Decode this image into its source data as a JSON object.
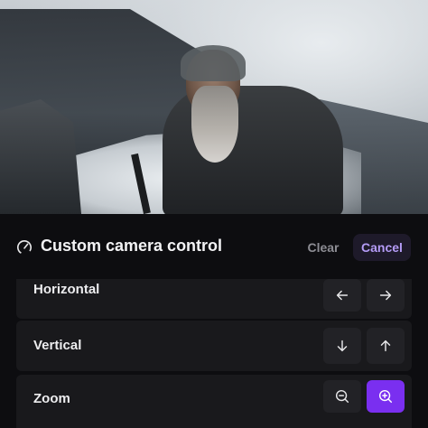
{
  "header": {
    "title": "Custom camera control",
    "clear_label": "Clear",
    "cancel_label": "Cancel",
    "icon": "gauge-icon"
  },
  "controls": [
    {
      "label": "Horizontal",
      "buttons": [
        "arrow-left-icon",
        "arrow-right-icon"
      ]
    },
    {
      "label": "Vertical",
      "buttons": [
        "arrow-down-icon",
        "arrow-up-icon"
      ]
    },
    {
      "label": "Zoom",
      "buttons": [
        "zoom-out-icon",
        "zoom-in-icon"
      ],
      "active": "zoom-in-icon"
    }
  ],
  "colors": {
    "panel_bg": "#0d0d10",
    "row_bg": "#19191c",
    "accent": "#7a2ff0",
    "cancel_text": "#b59cf7"
  }
}
